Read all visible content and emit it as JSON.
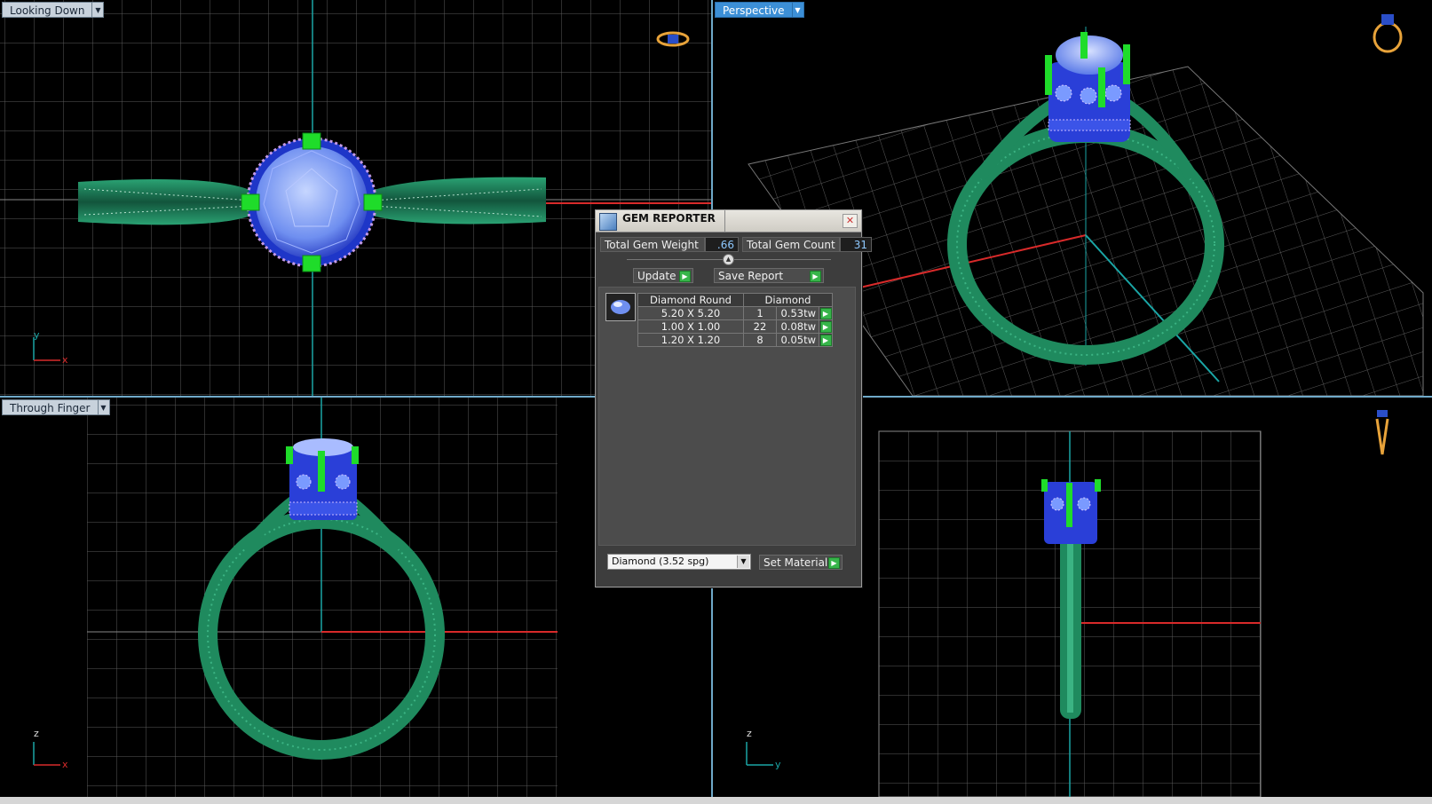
{
  "viewports": {
    "top": {
      "label": "Looking Down",
      "axis_vertical": "y",
      "axis_horizontal": "x"
    },
    "perspective": {
      "label": "Perspective"
    },
    "front": {
      "label": "Through Finger",
      "axis_vertical": "z",
      "axis_horizontal": "x"
    },
    "side": {
      "label": "",
      "axis_vertical": "z",
      "axis_horizontal": "y"
    }
  },
  "gem_reporter": {
    "title": "GEM REPORTER",
    "close_glyph": "✕",
    "total_weight_label": "Total Gem Weight",
    "total_weight_value": ".66",
    "total_count_label": "Total Gem Count",
    "total_count_value": "31",
    "update_label": "Update",
    "save_report_label": "Save Report",
    "table_header_shape": "Diamond Round",
    "table_header_material": "Diamond",
    "rows": [
      {
        "size": "5.20 X 5.20",
        "count": "1",
        "weight": "0.53tw"
      },
      {
        "size": "1.00 X 1.00",
        "count": "22",
        "weight": "0.08tw"
      },
      {
        "size": "1.20 X 1.20",
        "count": "8",
        "weight": "0.05tw"
      }
    ],
    "material_selected": "Diamond    (3.52 spg)",
    "set_material_label": "Set Material"
  },
  "colors": {
    "metal": "#1f8a5e",
    "gem": "#6f8ff0",
    "prong": "#1fdc2a",
    "grid": "#6a6a6a",
    "axis_x": "#d82a2a",
    "axis_y": "#1aa6a6"
  },
  "icons": [
    "view-cube-top-icon",
    "view-cube-perspective-icon",
    "view-cube-side-icon",
    "gem-thumbnail-icon",
    "gem-reporter-app-icon",
    "close-icon",
    "dropdown-arrow-icon",
    "go-arrow-icon"
  ]
}
